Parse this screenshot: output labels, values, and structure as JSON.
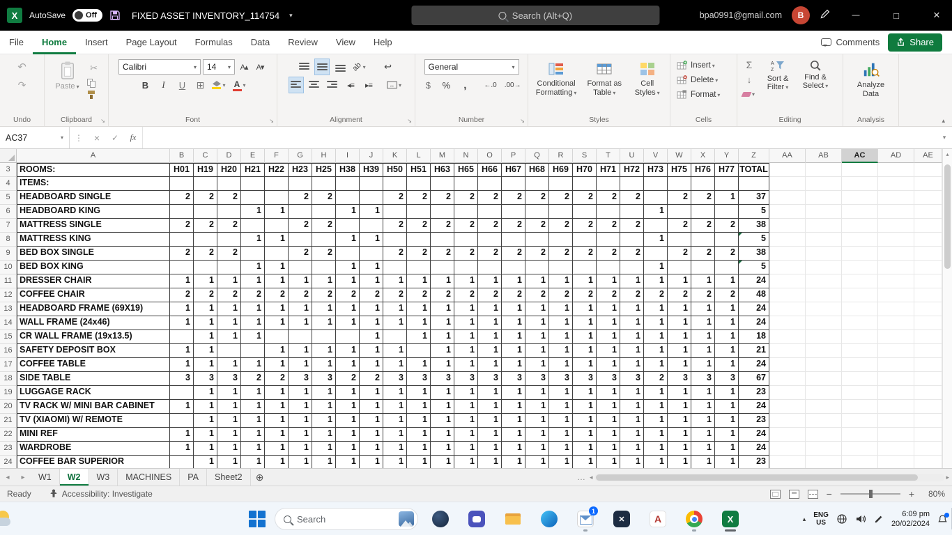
{
  "titlebar": {
    "autosave_label": "AutoSave",
    "autosave_state": "Off",
    "title": "FIXED ASSET INVENTORY_114754",
    "search_placeholder": "Search (Alt+Q)",
    "account_email": "bpa0991@gmail.com",
    "avatar_initial": "B"
  },
  "ribbon_tabs": {
    "items": [
      "File",
      "Home",
      "Insert",
      "Page Layout",
      "Formulas",
      "Data",
      "Review",
      "View",
      "Help"
    ],
    "active": "Home",
    "comments": "Comments",
    "share": "Share"
  },
  "ribbon": {
    "undo": {
      "label": "Undo"
    },
    "clipboard": {
      "label": "Clipboard",
      "paste": "Paste"
    },
    "font": {
      "label": "Font",
      "family": "Calibri",
      "size": "14"
    },
    "alignment": {
      "label": "Alignment"
    },
    "number": {
      "label": "Number",
      "format": "General"
    },
    "styles": {
      "label": "Styles",
      "buttons": [
        "Conditional Formatting",
        "Format as Table",
        "Cell Styles"
      ]
    },
    "cells": {
      "label": "Cells",
      "buttons": [
        "Insert",
        "Delete",
        "Format"
      ]
    },
    "editing": {
      "label": "Editing",
      "sort": "Sort & Filter",
      "find": "Find & Select"
    },
    "analysis": {
      "label": "Analysis",
      "button": "Analyze Data"
    }
  },
  "formula_bar": {
    "name_box": "AC37",
    "value": ""
  },
  "sheet": {
    "visible_columns": [
      "A",
      "B",
      "C",
      "D",
      "E",
      "F",
      "G",
      "H",
      "I",
      "J",
      "K",
      "L",
      "M",
      "N",
      "O",
      "P",
      "Q",
      "R",
      "S",
      "T",
      "U",
      "V",
      "W",
      "X",
      "Y",
      "Z",
      "AA",
      "AB",
      "AC",
      "AD",
      "AE"
    ],
    "selected_column": "AC",
    "rows_label_rooms": "ROOMS:",
    "rows_label_items": "ITEMS:",
    "room_headers": [
      "H01",
      "H19",
      "H20",
      "H21",
      "H22",
      "H23",
      "H25",
      "H38",
      "H39",
      "H50",
      "H51",
      "H63",
      "H65",
      "H66",
      "H67",
      "H68",
      "H69",
      "H70",
      "H71",
      "H72",
      "H73",
      "H75",
      "H76",
      "H77"
    ],
    "total_header": "TOTAL",
    "items": [
      {
        "row": 5,
        "name": "HEADBOARD SINGLE",
        "values": [
          "2",
          "2",
          "2",
          "",
          "",
          "2",
          "2",
          "",
          "",
          "2",
          "2",
          "2",
          "2",
          "2",
          "2",
          "2",
          "2",
          "2",
          "2",
          "2",
          "",
          "2",
          "2",
          "1"
        ],
        "total": "37",
        "flag": false
      },
      {
        "row": 6,
        "name": "HEADBOARD KING",
        "values": [
          "",
          "",
          "",
          "1",
          "1",
          "",
          "",
          "1",
          "1",
          "",
          "",
          "",
          "",
          "",
          "",
          "",
          "",
          "",
          "",
          "",
          "1",
          "",
          "",
          ""
        ],
        "total": "5",
        "flag": false
      },
      {
        "row": 7,
        "name": "MATTRESS SINGLE",
        "values": [
          "2",
          "2",
          "2",
          "",
          "",
          "2",
          "2",
          "",
          "",
          "2",
          "2",
          "2",
          "2",
          "2",
          "2",
          "2",
          "2",
          "2",
          "2",
          "2",
          "",
          "2",
          "2",
          "2"
        ],
        "total": "38",
        "flag": false
      },
      {
        "row": 8,
        "name": "MATTRESS KING",
        "values": [
          "",
          "",
          "",
          "1",
          "1",
          "",
          "",
          "1",
          "1",
          "",
          "",
          "",
          "",
          "",
          "",
          "",
          "",
          "",
          "",
          "",
          "1",
          "",
          "",
          ""
        ],
        "total": "5",
        "flag": true
      },
      {
        "row": 9,
        "name": "BED BOX SINGLE",
        "values": [
          "2",
          "2",
          "2",
          "",
          "",
          "2",
          "2",
          "",
          "",
          "2",
          "2",
          "2",
          "2",
          "2",
          "2",
          "2",
          "2",
          "2",
          "2",
          "2",
          "",
          "2",
          "2",
          "2"
        ],
        "total": "38",
        "flag": false
      },
      {
        "row": 10,
        "name": "BED BOX KING",
        "values": [
          "",
          "",
          "",
          "1",
          "1",
          "",
          "",
          "1",
          "1",
          "",
          "",
          "",
          "",
          "",
          "",
          "",
          "",
          "",
          "",
          "",
          "1",
          "",
          "",
          ""
        ],
        "total": "5",
        "flag": true
      },
      {
        "row": 11,
        "name": "DRESSER CHAIR",
        "values": [
          "1",
          "1",
          "1",
          "1",
          "1",
          "1",
          "1",
          "1",
          "1",
          "1",
          "1",
          "1",
          "1",
          "1",
          "1",
          "1",
          "1",
          "1",
          "1",
          "1",
          "1",
          "1",
          "1",
          "1"
        ],
        "total": "24",
        "flag": false
      },
      {
        "row": 12,
        "name": "COFFEE CHAIR",
        "values": [
          "2",
          "2",
          "2",
          "2",
          "2",
          "2",
          "2",
          "2",
          "2",
          "2",
          "2",
          "2",
          "2",
          "2",
          "2",
          "2",
          "2",
          "2",
          "2",
          "2",
          "2",
          "2",
          "2",
          "2"
        ],
        "total": "48",
        "flag": false
      },
      {
        "row": 13,
        "name": "HEADBOARD  FRAME (69X19)",
        "values": [
          "1",
          "1",
          "1",
          "1",
          "1",
          "1",
          "1",
          "1",
          "1",
          "1",
          "1",
          "1",
          "1",
          "1",
          "1",
          "1",
          "1",
          "1",
          "1",
          "1",
          "1",
          "1",
          "1",
          "1"
        ],
        "total": "24",
        "flag": false
      },
      {
        "row": 14,
        "name": "WALL FRAME (24x46)",
        "values": [
          "1",
          "1",
          "1",
          "1",
          "1",
          "1",
          "1",
          "1",
          "1",
          "1",
          "1",
          "1",
          "1",
          "1",
          "1",
          "1",
          "1",
          "1",
          "1",
          "1",
          "1",
          "1",
          "1",
          "1"
        ],
        "total": "24",
        "flag": false
      },
      {
        "row": 15,
        "name": "CR WALL FRAME (19x13.5)",
        "values": [
          "",
          "1",
          "1",
          "1",
          "",
          "",
          "",
          "",
          "1",
          "",
          "1",
          "1",
          "1",
          "1",
          "1",
          "1",
          "1",
          "1",
          "1",
          "1",
          "1",
          "1",
          "1",
          "1"
        ],
        "total": "18",
        "flag": false
      },
      {
        "row": 16,
        "name": "SAFETY DEPOSIT BOX",
        "values": [
          "1",
          "1",
          "",
          "",
          "1",
          "1",
          "1",
          "1",
          "1",
          "1",
          "",
          "1",
          "1",
          "1",
          "1",
          "1",
          "1",
          "1",
          "1",
          "1",
          "1",
          "1",
          "1",
          "1"
        ],
        "total": "21",
        "flag": false
      },
      {
        "row": 17,
        "name": "COFFEE TABLE",
        "values": [
          "1",
          "1",
          "1",
          "1",
          "1",
          "1",
          "1",
          "1",
          "1",
          "1",
          "1",
          "1",
          "1",
          "1",
          "1",
          "1",
          "1",
          "1",
          "1",
          "1",
          "1",
          "1",
          "1",
          "1"
        ],
        "total": "24",
        "flag": false
      },
      {
        "row": 18,
        "name": "SIDE TABLE",
        "values": [
          "3",
          "3",
          "3",
          "2",
          "2",
          "3",
          "3",
          "2",
          "2",
          "3",
          "3",
          "3",
          "3",
          "3",
          "3",
          "3",
          "3",
          "3",
          "3",
          "3",
          "2",
          "3",
          "3",
          "3"
        ],
        "total": "67",
        "flag": false
      },
      {
        "row": 19,
        "name": "LUGGAGE RACK",
        "values": [
          "",
          "1",
          "1",
          "1",
          "1",
          "1",
          "1",
          "1",
          "1",
          "1",
          "1",
          "1",
          "1",
          "1",
          "1",
          "1",
          "1",
          "1",
          "1",
          "1",
          "1",
          "1",
          "1",
          "1"
        ],
        "total": "23",
        "flag": false
      },
      {
        "row": 20,
        "name": "TV RACK W/ MINI BAR CABINET",
        "values": [
          "1",
          "1",
          "1",
          "1",
          "1",
          "1",
          "1",
          "1",
          "1",
          "1",
          "1",
          "1",
          "1",
          "1",
          "1",
          "1",
          "1",
          "1",
          "1",
          "1",
          "1",
          "1",
          "1",
          "1"
        ],
        "total": "24",
        "flag": false
      },
      {
        "row": 21,
        "name": "TV (XIAOMI) W/ REMOTE",
        "values": [
          "",
          "1",
          "1",
          "1",
          "1",
          "1",
          "1",
          "1",
          "1",
          "1",
          "1",
          "1",
          "1",
          "1",
          "1",
          "1",
          "1",
          "1",
          "1",
          "1",
          "1",
          "1",
          "1",
          "1"
        ],
        "total": "23",
        "flag": false
      },
      {
        "row": 22,
        "name": "MINI REF",
        "values": [
          "1",
          "1",
          "1",
          "1",
          "1",
          "1",
          "1",
          "1",
          "1",
          "1",
          "1",
          "1",
          "1",
          "1",
          "1",
          "1",
          "1",
          "1",
          "1",
          "1",
          "1",
          "1",
          "1",
          "1"
        ],
        "total": "24",
        "flag": false
      },
      {
        "row": 23,
        "name": "WARDROBE",
        "values": [
          "1",
          "1",
          "1",
          "1",
          "1",
          "1",
          "1",
          "1",
          "1",
          "1",
          "1",
          "1",
          "1",
          "1",
          "1",
          "1",
          "1",
          "1",
          "1",
          "1",
          "1",
          "1",
          "1",
          "1"
        ],
        "total": "24",
        "flag": false
      },
      {
        "row": 24,
        "name": "COFFEE BAR SUPERIOR",
        "values": [
          "",
          "1",
          "1",
          "1",
          "1",
          "1",
          "1",
          "1",
          "1",
          "1",
          "1",
          "1",
          "1",
          "1",
          "1",
          "1",
          "1",
          "1",
          "1",
          "1",
          "1",
          "1",
          "1",
          "1"
        ],
        "total": "23",
        "flag": false
      }
    ]
  },
  "sheet_tabs": {
    "tabs": [
      "W1",
      "W2",
      "W3",
      "MACHINES",
      "PA",
      "Sheet2"
    ],
    "active": "W2"
  },
  "status_bar": {
    "mode": "Ready",
    "accessibility": "Accessibility: Investigate",
    "zoom": "80%"
  },
  "taskbar": {
    "search": "Search",
    "mail_badge": "1",
    "tray": {
      "lang_top": "ENG",
      "lang_bottom": "US",
      "time": "6:09 pm",
      "date": "20/02/2024"
    }
  },
  "icons": {
    "chevron_down": "▾",
    "undo": "↶",
    "redo": "↷",
    "scissors": "✂",
    "sigma": "Σ",
    "percent": "%",
    "currency": "$",
    "wrap_text": "↩",
    "new_sheet": "⊕"
  }
}
